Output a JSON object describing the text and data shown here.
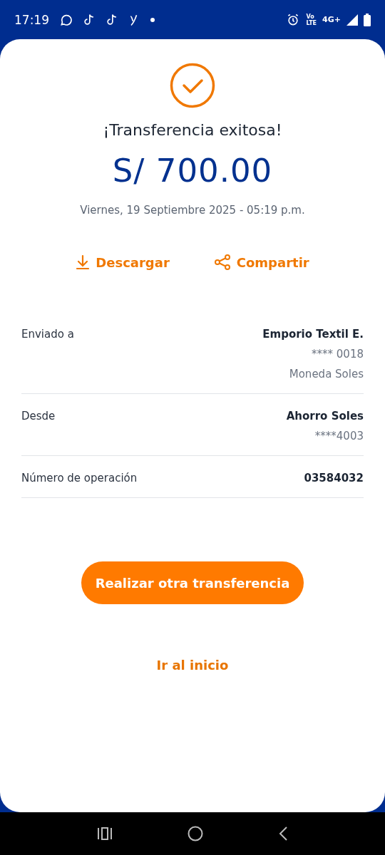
{
  "status_bar": {
    "time": "17:19",
    "volte": [
      "Vo",
      "LTE"
    ],
    "network": "4G+"
  },
  "receipt": {
    "title": "¡Transferencia exitosa!",
    "amount": "S/ 700.00",
    "date": "Viernes, 19 Septiembre 2025 - 05:19 p.m.",
    "actions": [
      {
        "kind": "download",
        "label": "Descargar"
      },
      {
        "kind": "share",
        "label": "Compartir"
      }
    ],
    "details": [
      {
        "label": "Enviado a",
        "values": [
          {
            "kind": "primary",
            "text": "Emporio Textil E."
          },
          {
            "kind": "secondary",
            "text": "**** 0018"
          },
          {
            "kind": "secondary",
            "text": "Moneda Soles"
          }
        ]
      },
      {
        "label": "Desde",
        "values": [
          {
            "kind": "primary",
            "text": "Ahorro Soles"
          },
          {
            "kind": "secondary",
            "text": "****4003"
          }
        ]
      },
      {
        "label": "Número de operación",
        "values": [
          {
            "kind": "primary",
            "text": "03584032"
          }
        ]
      }
    ],
    "primary_button": "Realizar otra transferencia",
    "link": "Ir al inicio"
  }
}
